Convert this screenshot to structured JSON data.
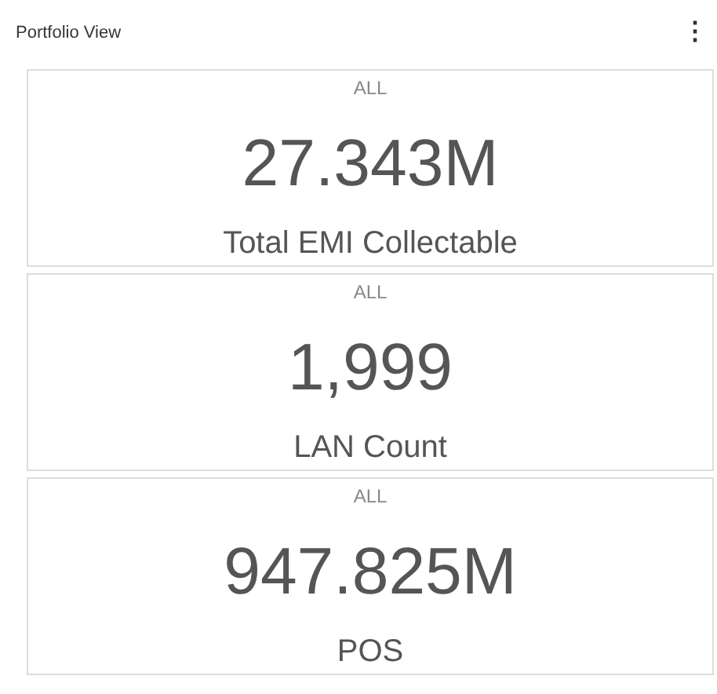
{
  "panel": {
    "title": "Portfolio View",
    "menu_icon": "⋮"
  },
  "cards": [
    {
      "filter": "ALL",
      "value": "27.343M",
      "label": "Total EMI Collectable"
    },
    {
      "filter": "ALL",
      "value": "1,999",
      "label": "LAN Count"
    },
    {
      "filter": "ALL",
      "value": "947.825M",
      "label": "POS"
    }
  ]
}
